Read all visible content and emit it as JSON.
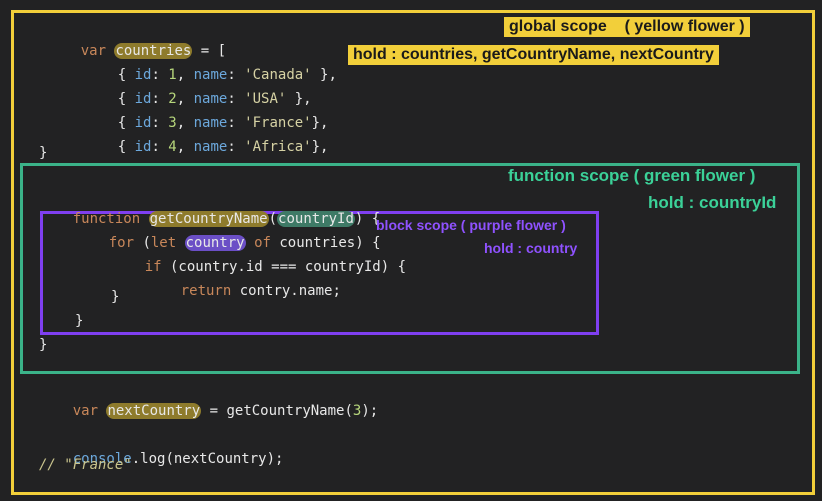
{
  "code": {
    "l1": {
      "kw": "var",
      "ident": "countries",
      "rest": " = ["
    },
    "rows": [
      {
        "open": "{ ",
        "id_key": "id",
        "colon1": ": ",
        "id": "1",
        "comma1": ", ",
        "name_key": "name",
        "colon2": ": ",
        "name": "'Canada'",
        "close": " },"
      },
      {
        "open": "{ ",
        "id_key": "id",
        "colon1": ": ",
        "id": "2",
        "comma1": ", ",
        "name_key": "name",
        "colon2": ": ",
        "name": "'USA'",
        "close": " },"
      },
      {
        "open": "{ ",
        "id_key": "id",
        "colon1": ": ",
        "id": "3",
        "comma1": ", ",
        "name_key": "name",
        "colon2": ": ",
        "name": "'France'",
        "close": "},"
      },
      {
        "open": "{ ",
        "id_key": "id",
        "colon1": ": ",
        "id": "4",
        "comma1": ", ",
        "name_key": "name",
        "colon2": ": ",
        "name": "'Africa'",
        "close": "},"
      }
    ],
    "l6": "}",
    "l7": {
      "kw": "function",
      "name": "getCountryName",
      "open": "(",
      "param": "countryId",
      "rest": ") {"
    },
    "l8": {
      "kw1": "for",
      "p1": " (",
      "kw2": "let",
      "ident": "country",
      "kw3": "of",
      "rest": " countries) {"
    },
    "l9": {
      "kw": "if",
      "rest": " (country.id === countryId) {"
    },
    "l10": {
      "kw": "return",
      "rest": " contry.name;"
    },
    "l11": "}",
    "l12": "}",
    "l13": "}",
    "l14": {
      "kw": "var",
      "ident": "nextCountry",
      "rest1": " = getCountryName(",
      "num": "3",
      "rest2": ");"
    },
    "l15": {
      "obj": "console",
      "rest": ".log(nextCountry);"
    },
    "l16": "// \"France\""
  },
  "labels": {
    "global_title": "global scope    ( yellow flower )",
    "global_hold": "hold : countries, getCountryName, nextCountry",
    "function_title": "function scope ( green flower )",
    "function_hold": "hold : countryId",
    "block_title": "block scope ( purple flower )",
    "block_hold": "hold : country"
  },
  "colors": {
    "global": "#f2cf3a",
    "function": "#3bb389",
    "block": "#7f3ff0",
    "background": "#222223"
  }
}
